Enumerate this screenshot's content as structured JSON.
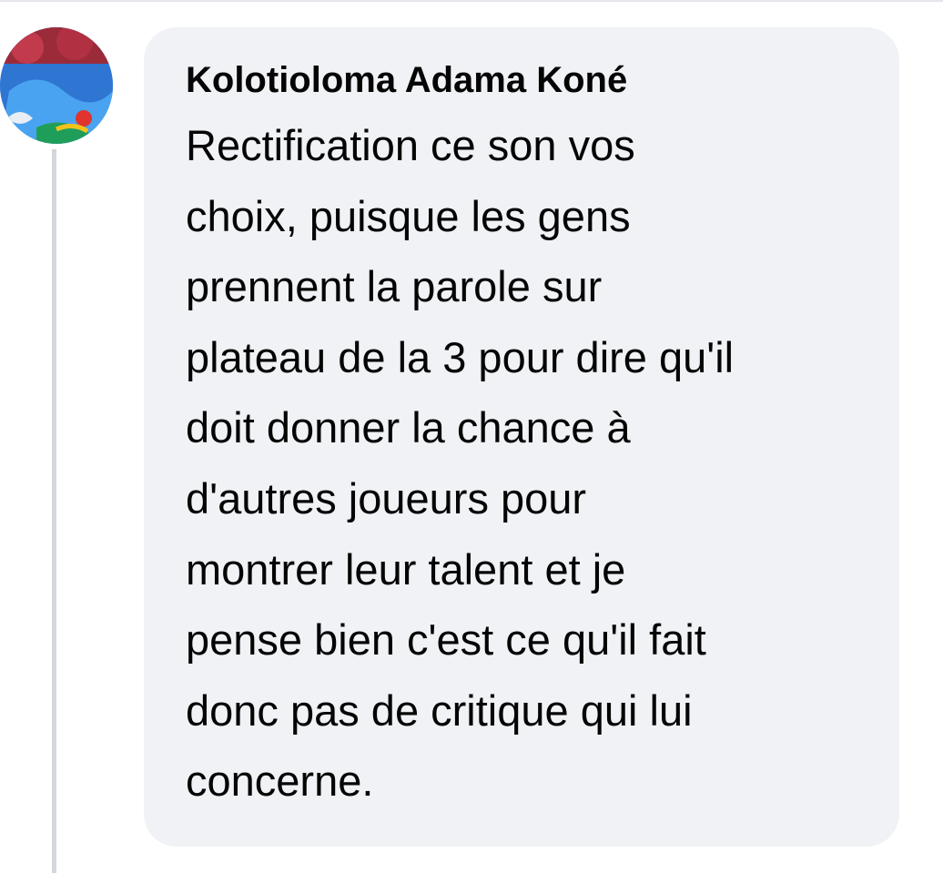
{
  "comment": {
    "author": "Kolotioloma Adama Koné",
    "lines": [
      "Rectification ce son vos",
      "choix, puisque les gens",
      "prennent la parole sur",
      "plateau de la 3 pour dire qu'il",
      "doit donner la chance à",
      "d'autres joueurs pour",
      "montrer leur talent et je",
      "pense bien c'est ce qu'il fait",
      "donc pas de critique qui lui",
      "concerne."
    ]
  },
  "colors": {
    "bubble_background": "#f0f2f5",
    "text": "#050505",
    "thread_line": "#d3d6db"
  }
}
